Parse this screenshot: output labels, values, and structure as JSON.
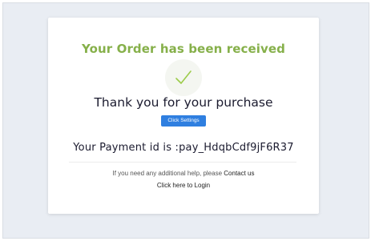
{
  "page": {
    "title": "Your Order has been received",
    "thank_you": "Thank you for your purchase",
    "button_label": "Click Settings",
    "payment_text": "Your Payment id is :pay_HdqbCdf9jF6R37",
    "help_text": "If you need any additional help, please",
    "contact_link": "Contact us",
    "login_link": "Click here to Login"
  },
  "icons": {
    "checkmark": "checkmark-icon"
  },
  "colors": {
    "title": "#86b04a",
    "checkmark": "#9ccc4a",
    "button": "#2f7fe0",
    "background": "#e9edf3"
  }
}
